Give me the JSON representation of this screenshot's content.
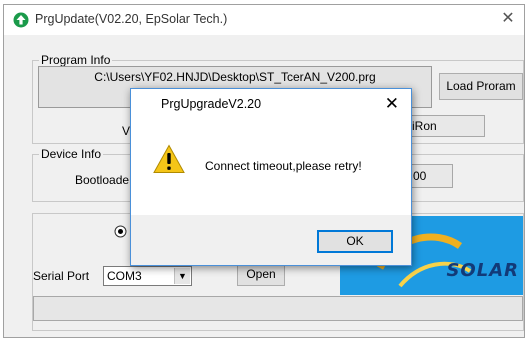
{
  "window": {
    "title": "PrgUpdate(V02.20, EpSolar Tech.)",
    "close_glyph": "✕"
  },
  "program_info": {
    "group_title": "Program Info",
    "path": "C:\\Users\\YF02.HNJD\\Desktop\\ST_TcerAN_V200.prg",
    "load_button": "Load Proram",
    "partial_label": "V",
    "partial_value": "iRon"
  },
  "device_info": {
    "group_title": "Device Info",
    "bootloader_label": "Bootloade",
    "partial_value": "00"
  },
  "serial": {
    "label": "Serial Port",
    "port_value": "COM3",
    "open_button": "Open"
  },
  "logo": {
    "text": "SOLAR"
  },
  "dialog": {
    "title": "PrgUpgradeV2.20",
    "close_glyph": "✕",
    "message": "Connect timeout,please retry!",
    "ok_label": "OK"
  },
  "colors": {
    "window_bg": "#f0f0f0",
    "accent": "#0078d7",
    "logo_bg": "#1e9be3",
    "logo_text": "#123a78"
  }
}
